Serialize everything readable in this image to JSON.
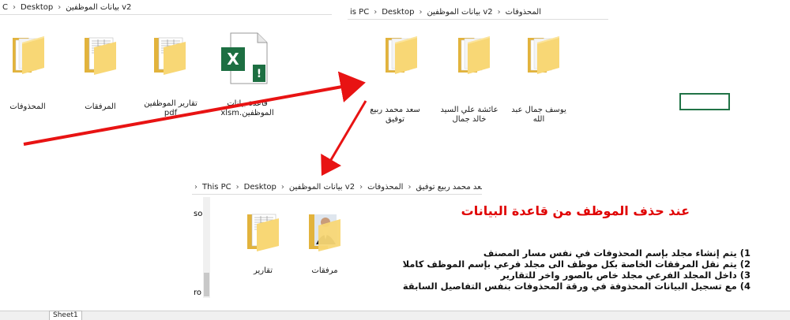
{
  "explorer_top_left": {
    "breadcrumb": [
      "C",
      "Desktop",
      "بيانات الموظفين v2"
    ],
    "items": [
      {
        "label": "المحذوفات"
      },
      {
        "label": "المرفقات"
      },
      {
        "label": "تقارير الموظفين pdf"
      },
      {
        "label": "قاعدة بيانات الموظفين.xlsm"
      }
    ]
  },
  "explorer_top_right": {
    "breadcrumb": [
      "is PC",
      "Desktop",
      "بيانات الموظفين v2",
      "المحذوفات"
    ],
    "items": [
      {
        "label": "سعد محمد ربيع توفيق"
      },
      {
        "label": "عائشة علي السيد خالد جمال"
      },
      {
        "label": "يوسف جمال عبد الله"
      }
    ]
  },
  "explorer_bottom": {
    "breadcrumb": [
      "This PC",
      "Desktop",
      "بيانات الموظفين v2",
      "المحذوفات",
      "سعد محمد ربيع توفيق"
    ],
    "items": [
      {
        "label": "تقارير"
      },
      {
        "label": "مرفقات"
      }
    ],
    "side_fragments": [
      "sor",
      "ro F"
    ]
  },
  "annotation": {
    "title": "عند  حذف الموظف من قاعدة البيانات",
    "steps": [
      "1)  يتم إنشاء مجلد بإسم المحذوفات في نفس مسار المصنف",
      "2) يتم نقل المرفقات الخاصة بكل موظف الى مجلد فرعي بإسم الموظف كاملا",
      "3) داخل المجلد الفرعي  مجلد خاص بالصور واخر للتقارير",
      "4) مع تسجيل البيانات المحذوفة في ورقة المحذوفات بنفس التفاصيل السابقة"
    ]
  },
  "excel": {
    "sheet_tab": "Sheet1",
    "icon_letter": "X"
  },
  "colors": {
    "arrow": "#e81313",
    "folder_front": "#f8d775",
    "folder_back": "#e2b33c",
    "excel_green": "#1d6f42",
    "title_red": "#e00000"
  }
}
